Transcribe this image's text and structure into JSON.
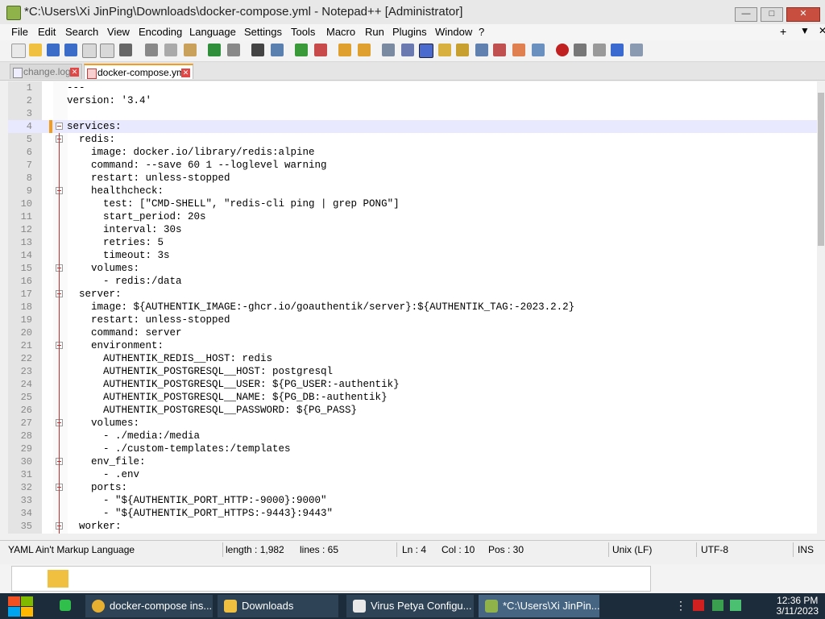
{
  "window": {
    "title": "*C:\\Users\\Xi JinPing\\Downloads\\docker-compose.yml - Notepad++ [Administrator]",
    "minimize": "—",
    "maximize": "□",
    "close": "✕"
  },
  "menu": {
    "items": [
      "File",
      "Edit",
      "Search",
      "View",
      "Encoding",
      "Language",
      "Settings",
      "Tools",
      "Macro",
      "Run",
      "Plugins",
      "Window",
      "?"
    ],
    "plus": "+",
    "dropdown": "▼",
    "close": "✕"
  },
  "tabs": [
    {
      "label": "change.log",
      "active": false
    },
    {
      "label": "docker-compose.yml",
      "active": true
    }
  ],
  "editor": {
    "current_line": 4,
    "lines": [
      {
        "n": "1",
        "text": "---"
      },
      {
        "n": "2",
        "text": "version: '3.4'"
      },
      {
        "n": "3",
        "text": ""
      },
      {
        "n": "4",
        "text": "services:"
      },
      {
        "n": "5",
        "text": "  redis:"
      },
      {
        "n": "6",
        "text": "    image: docker.io/library/redis:alpine"
      },
      {
        "n": "7",
        "text": "    command: --save 60 1 --loglevel warning"
      },
      {
        "n": "8",
        "text": "    restart: unless-stopped"
      },
      {
        "n": "9",
        "text": "    healthcheck:"
      },
      {
        "n": "10",
        "text": "      test: [\"CMD-SHELL\", \"redis-cli ping | grep PONG\"]"
      },
      {
        "n": "11",
        "text": "      start_period: 20s"
      },
      {
        "n": "12",
        "text": "      interval: 30s"
      },
      {
        "n": "13",
        "text": "      retries: 5"
      },
      {
        "n": "14",
        "text": "      timeout: 3s"
      },
      {
        "n": "15",
        "text": "    volumes:"
      },
      {
        "n": "16",
        "text": "      - redis:/data"
      },
      {
        "n": "17",
        "text": "  server:"
      },
      {
        "n": "18",
        "text": "    image: ${AUTHENTIK_IMAGE:-ghcr.io/goauthentik/server}:${AUTHENTIK_TAG:-2023.2.2}"
      },
      {
        "n": "19",
        "text": "    restart: unless-stopped"
      },
      {
        "n": "20",
        "text": "    command: server"
      },
      {
        "n": "21",
        "text": "    environment:"
      },
      {
        "n": "22",
        "text": "      AUTHENTIK_REDIS__HOST: redis"
      },
      {
        "n": "23",
        "text": "      AUTHENTIK_POSTGRESQL__HOST: postgresql"
      },
      {
        "n": "24",
        "text": "      AUTHENTIK_POSTGRESQL__USER: ${PG_USER:-authentik}"
      },
      {
        "n": "25",
        "text": "      AUTHENTIK_POSTGRESQL__NAME: ${PG_DB:-authentik}"
      },
      {
        "n": "26",
        "text": "      AUTHENTIK_POSTGRESQL__PASSWORD: ${PG_PASS}"
      },
      {
        "n": "27",
        "text": "    volumes:"
      },
      {
        "n": "28",
        "text": "      - ./media:/media"
      },
      {
        "n": "29",
        "text": "      - ./custom-templates:/templates"
      },
      {
        "n": "30",
        "text": "    env_file:"
      },
      {
        "n": "31",
        "text": "      - .env"
      },
      {
        "n": "32",
        "text": "    ports:"
      },
      {
        "n": "33",
        "text": "      - \"${AUTHENTIK_PORT_HTTP:-9000}:9000\""
      },
      {
        "n": "34",
        "text": "      - \"${AUTHENTIK_PORT_HTTPS:-9443}:9443\""
      },
      {
        "n": "35",
        "text": "  worker:"
      }
    ]
  },
  "status": {
    "language": "YAML Ain't Markup Language",
    "length": "length : 1,982",
    "lines": "lines : 65",
    "ln": "Ln : 4",
    "col": "Col : 10",
    "pos": "Pos : 30",
    "eol": "Unix (LF)",
    "encoding": "UTF-8",
    "mode": "INS"
  },
  "taskbar": {
    "tasks": [
      "docker-compose ins...",
      "Downloads",
      "Virus Petya Configu...",
      "*C:\\Users\\Xi JinPin..."
    ],
    "time": "12:36 PM",
    "date": "3/11/2023"
  },
  "colors": {
    "accent": "#f39c1e",
    "fold": "#c03030",
    "keyword": "#000080",
    "taskbar": "#1d2c3a"
  }
}
